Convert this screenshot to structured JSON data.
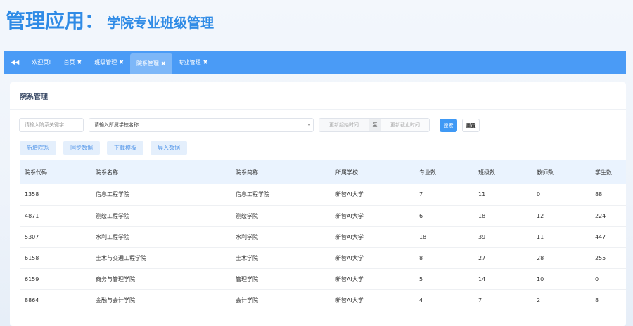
{
  "header": {
    "title": "管理应用：",
    "subtitle": "学院专业班级管理"
  },
  "tabs": [
    {
      "label": "欢迎页!",
      "closable": false
    },
    {
      "label": "首页",
      "closable": true
    },
    {
      "label": "班级管理",
      "closable": true
    },
    {
      "label": "院系管理",
      "closable": true,
      "active": true
    },
    {
      "label": "专业管理",
      "closable": true
    }
  ],
  "card": {
    "title": "院系管理"
  },
  "filters": {
    "keyword_placeholder": "请输入院系关键字",
    "school_placeholder": "请输入所属学校名称",
    "start_placeholder": "更新起始时间",
    "to_label": "至",
    "end_placeholder": "更新截止时间",
    "search_label": "搜索",
    "reset_label": "重置"
  },
  "actions": [
    "新增院系",
    "同步数据",
    "下载模板",
    "导入数据"
  ],
  "table": {
    "headers": [
      "院系代码",
      "院系名称",
      "院系简称",
      "所属学校",
      "专业数",
      "班级数",
      "教师数",
      "学生数"
    ],
    "rows": [
      [
        "1358",
        "信息工程学院",
        "信息工程学院",
        "新智AI大学",
        "7",
        "11",
        "0",
        "88"
      ],
      [
        "4871",
        "测绘工程学院",
        "测绘学院",
        "新智AI大学",
        "6",
        "18",
        "12",
        "224"
      ],
      [
        "5307",
        "水利工程学院",
        "水利学院",
        "新智AI大学",
        "18",
        "39",
        "11",
        "447"
      ],
      [
        "6158",
        "土木与交通工程学院",
        "土木学院",
        "新智AI大学",
        "8",
        "27",
        "28",
        "255"
      ],
      [
        "6159",
        "商务与管理学院",
        "管理学院",
        "新智AI大学",
        "5",
        "14",
        "10",
        "0"
      ],
      [
        "8864",
        "金融与会计学院",
        "会计学院",
        "新智AI大学",
        "4",
        "7",
        "2",
        "8"
      ]
    ]
  }
}
